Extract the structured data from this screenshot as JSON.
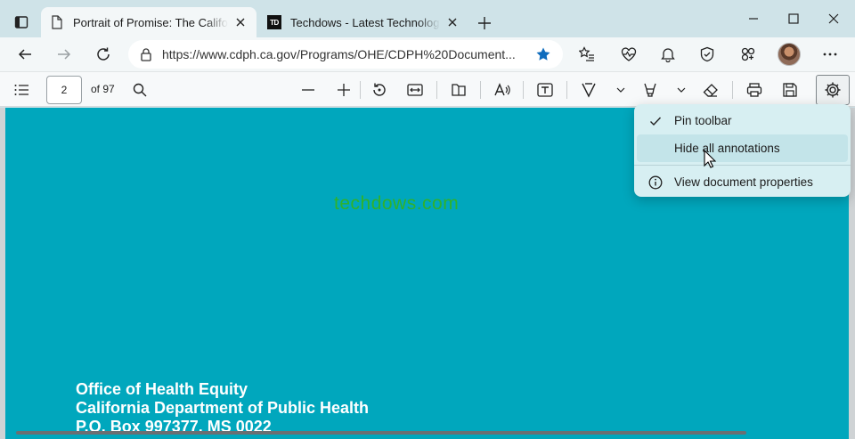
{
  "tabs": [
    {
      "title": "Portrait of Promise: The California Statewide Plan",
      "favicon": "document-icon",
      "active": true
    },
    {
      "title": "Techdows - Latest Technology News",
      "favicon": "TD",
      "active": false
    }
  ],
  "address_bar": {
    "url": "https://www.cdph.ca.gov/Programs/OHE/CDPH%20Document..."
  },
  "pdf_toolbar": {
    "page_number": "2",
    "page_count": "of 97"
  },
  "settings_menu": {
    "items": [
      {
        "label": "Pin toolbar",
        "icon": "checkmark-icon"
      },
      {
        "label": "Hide all annotations",
        "icon": ""
      },
      {
        "label": "View document properties",
        "icon": "info-icon"
      }
    ]
  },
  "document": {
    "watermark": "techdows.com",
    "lines": [
      "Office of Health Equity",
      "California Department of Public Health",
      "P.O. Box 997377, MS 0022"
    ]
  },
  "colors": {
    "page_background": "#00a7bd",
    "accent_star": "#0f6cbd",
    "watermark": "#2fb22a"
  }
}
